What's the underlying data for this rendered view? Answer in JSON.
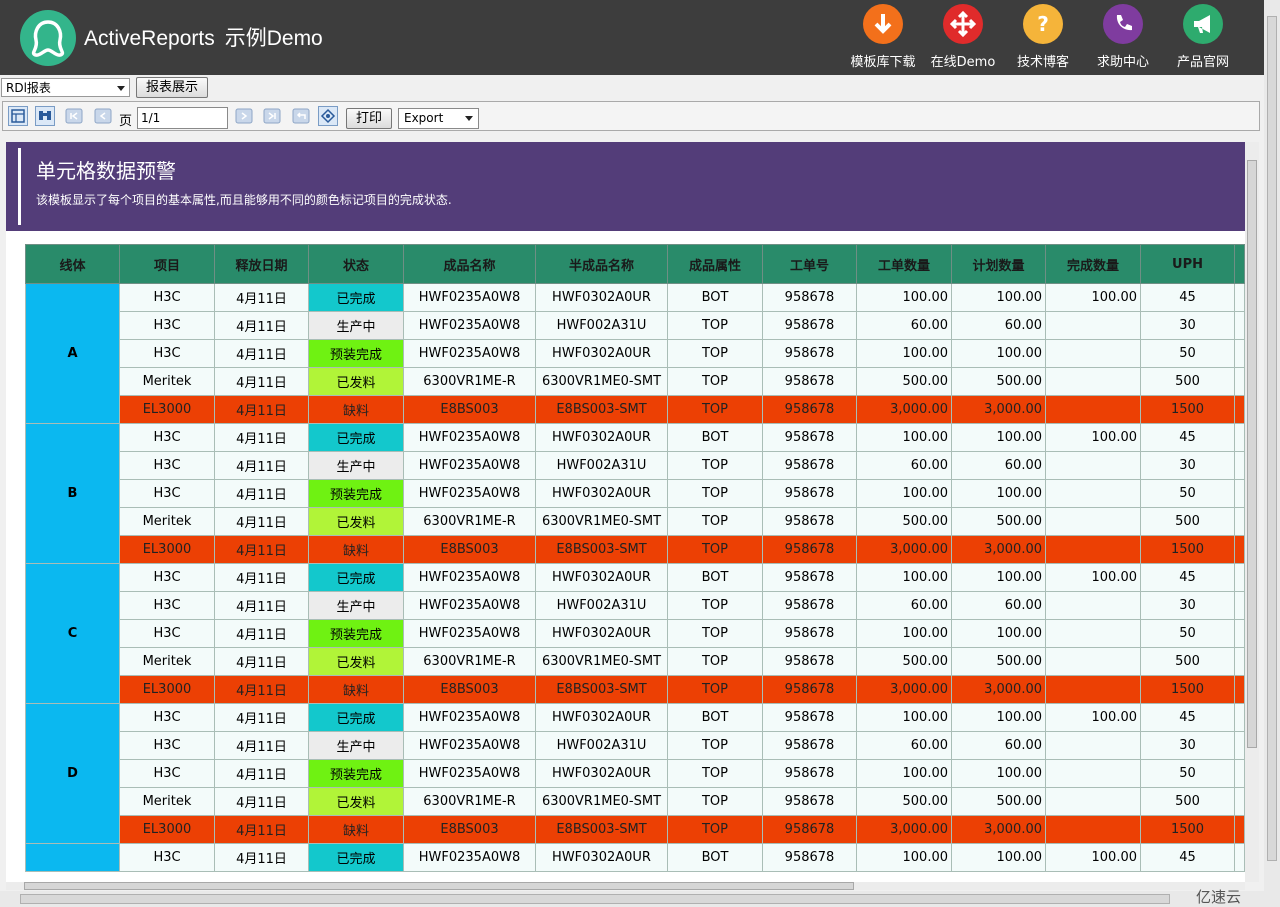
{
  "brand": {
    "title": "ActiveReports",
    "subtitle": "示例Demo"
  },
  "nav": [
    {
      "label": "模板库下载",
      "icon": "download-icon",
      "color": "#f3701b"
    },
    {
      "label": "在线Demo",
      "icon": "move-arrows-icon",
      "color": "#e02b2b"
    },
    {
      "label": "技术博客",
      "icon": "question-icon",
      "color": "#f5b43a"
    },
    {
      "label": "求助中心",
      "icon": "phone-icon",
      "color": "#7f3c9f"
    },
    {
      "label": "产品官网",
      "icon": "megaphone-icon",
      "color": "#2eab6e"
    }
  ],
  "report_select": {
    "value": "RDl报表"
  },
  "show_button": "报表展示",
  "toolbar": {
    "page_label": "页",
    "page_value": "1/1",
    "print_label": "打印",
    "export_value": "Export"
  },
  "report": {
    "title": "单元格数据预警",
    "description": "该模板显示了每个项目的基本属性,而且能够用不同的颜色标记项目的完成状态.",
    "columns": [
      "线体",
      "项目",
      "释放日期",
      "状态",
      "成品名称",
      "半成品名称",
      "成品属性",
      "工单号",
      "工单数量",
      "计划数量",
      "完成数量",
      "UPH"
    ],
    "groups": [
      {
        "line": "A",
        "rows": [
          {
            "project": "H3C",
            "date": "4月11日",
            "status": "已完成",
            "product": "HWF0235A0W8",
            "semi": "HWF0302A0UR",
            "attr": "BOT",
            "order": "958678",
            "qty": "100.00",
            "plan": "100.00",
            "done": "100.00",
            "uph": "45"
          },
          {
            "project": "H3C",
            "date": "4月11日",
            "status": "生产中",
            "product": "HWF0235A0W8",
            "semi": "HWF002A31U",
            "attr": "TOP",
            "order": "958678",
            "qty": "60.00",
            "plan": "60.00",
            "done": "",
            "uph": "30"
          },
          {
            "project": "H3C",
            "date": "4月11日",
            "status": "预装完成",
            "product": "HWF0235A0W8",
            "semi": "HWF0302A0UR",
            "attr": "TOP",
            "order": "958678",
            "qty": "100.00",
            "plan": "100.00",
            "done": "",
            "uph": "50"
          },
          {
            "project": "Meritek",
            "date": "4月11日",
            "status": "已发料",
            "product": "6300VR1ME-R",
            "semi": "6300VR1ME0-SMT",
            "attr": "TOP",
            "order": "958678",
            "qty": "500.00",
            "plan": "500.00",
            "done": "",
            "uph": "500"
          },
          {
            "project": "EL3000",
            "date": "4月11日",
            "status": "缺料",
            "product": "E8BS003",
            "semi": "E8BS003-SMT",
            "attr": "TOP",
            "order": "958678",
            "qty": "3,000.00",
            "plan": "3,000.00",
            "done": "",
            "uph": "1500"
          }
        ]
      },
      {
        "line": "B",
        "rows": [
          {
            "project": "H3C",
            "date": "4月11日",
            "status": "已完成",
            "product": "HWF0235A0W8",
            "semi": "HWF0302A0UR",
            "attr": "BOT",
            "order": "958678",
            "qty": "100.00",
            "plan": "100.00",
            "done": "100.00",
            "uph": "45"
          },
          {
            "project": "H3C",
            "date": "4月11日",
            "status": "生产中",
            "product": "HWF0235A0W8",
            "semi": "HWF002A31U",
            "attr": "TOP",
            "order": "958678",
            "qty": "60.00",
            "plan": "60.00",
            "done": "",
            "uph": "30"
          },
          {
            "project": "H3C",
            "date": "4月11日",
            "status": "预装完成",
            "product": "HWF0235A0W8",
            "semi": "HWF0302A0UR",
            "attr": "TOP",
            "order": "958678",
            "qty": "100.00",
            "plan": "100.00",
            "done": "",
            "uph": "50"
          },
          {
            "project": "Meritek",
            "date": "4月11日",
            "status": "已发料",
            "product": "6300VR1ME-R",
            "semi": "6300VR1ME0-SMT",
            "attr": "TOP",
            "order": "958678",
            "qty": "500.00",
            "plan": "500.00",
            "done": "",
            "uph": "500"
          },
          {
            "project": "EL3000",
            "date": "4月11日",
            "status": "缺料",
            "product": "E8BS003",
            "semi": "E8BS003-SMT",
            "attr": "TOP",
            "order": "958678",
            "qty": "3,000.00",
            "plan": "3,000.00",
            "done": "",
            "uph": "1500"
          }
        ]
      },
      {
        "line": "C",
        "rows": [
          {
            "project": "H3C",
            "date": "4月11日",
            "status": "已完成",
            "product": "HWF0235A0W8",
            "semi": "HWF0302A0UR",
            "attr": "BOT",
            "order": "958678",
            "qty": "100.00",
            "plan": "100.00",
            "done": "100.00",
            "uph": "45"
          },
          {
            "project": "H3C",
            "date": "4月11日",
            "status": "生产中",
            "product": "HWF0235A0W8",
            "semi": "HWF002A31U",
            "attr": "TOP",
            "order": "958678",
            "qty": "60.00",
            "plan": "60.00",
            "done": "",
            "uph": "30"
          },
          {
            "project": "H3C",
            "date": "4月11日",
            "status": "预装完成",
            "product": "HWF0235A0W8",
            "semi": "HWF0302A0UR",
            "attr": "TOP",
            "order": "958678",
            "qty": "100.00",
            "plan": "100.00",
            "done": "",
            "uph": "50"
          },
          {
            "project": "Meritek",
            "date": "4月11日",
            "status": "已发料",
            "product": "6300VR1ME-R",
            "semi": "6300VR1ME0-SMT",
            "attr": "TOP",
            "order": "958678",
            "qty": "500.00",
            "plan": "500.00",
            "done": "",
            "uph": "500"
          },
          {
            "project": "EL3000",
            "date": "4月11日",
            "status": "缺料",
            "product": "E8BS003",
            "semi": "E8BS003-SMT",
            "attr": "TOP",
            "order": "958678",
            "qty": "3,000.00",
            "plan": "3,000.00",
            "done": "",
            "uph": "1500"
          }
        ]
      },
      {
        "line": "D",
        "rows": [
          {
            "project": "H3C",
            "date": "4月11日",
            "status": "已完成",
            "product": "HWF0235A0W8",
            "semi": "HWF0302A0UR",
            "attr": "BOT",
            "order": "958678",
            "qty": "100.00",
            "plan": "100.00",
            "done": "100.00",
            "uph": "45"
          },
          {
            "project": "H3C",
            "date": "4月11日",
            "status": "生产中",
            "product": "HWF0235A0W8",
            "semi": "HWF002A31U",
            "attr": "TOP",
            "order": "958678",
            "qty": "60.00",
            "plan": "60.00",
            "done": "",
            "uph": "30"
          },
          {
            "project": "H3C",
            "date": "4月11日",
            "status": "预装完成",
            "product": "HWF0235A0W8",
            "semi": "HWF0302A0UR",
            "attr": "TOP",
            "order": "958678",
            "qty": "100.00",
            "plan": "100.00",
            "done": "",
            "uph": "50"
          },
          {
            "project": "Meritek",
            "date": "4月11日",
            "status": "已发料",
            "product": "6300VR1ME-R",
            "semi": "6300VR1ME0-SMT",
            "attr": "TOP",
            "order": "958678",
            "qty": "500.00",
            "plan": "500.00",
            "done": "",
            "uph": "500"
          },
          {
            "project": "EL3000",
            "date": "4月11日",
            "status": "缺料",
            "product": "E8BS003",
            "semi": "E8BS003-SMT",
            "attr": "TOP",
            "order": "958678",
            "qty": "3,000.00",
            "plan": "3,000.00",
            "done": "",
            "uph": "1500"
          }
        ]
      },
      {
        "line": "",
        "rows": [
          {
            "project": "H3C",
            "date": "4月11日",
            "status": "已完成",
            "product": "HWF0235A0W8",
            "semi": "HWF0302A0UR",
            "attr": "BOT",
            "order": "958678",
            "qty": "100.00",
            "plan": "100.00",
            "done": "100.00",
            "uph": "45"
          }
        ]
      }
    ],
    "status_colors": {
      "已完成": "#13c8cc",
      "生产中": "#ececec",
      "预装完成": "#6ff212",
      "已发料": "#b1f438",
      "缺料": "#ec4004"
    }
  },
  "watermark": "亿速云"
}
